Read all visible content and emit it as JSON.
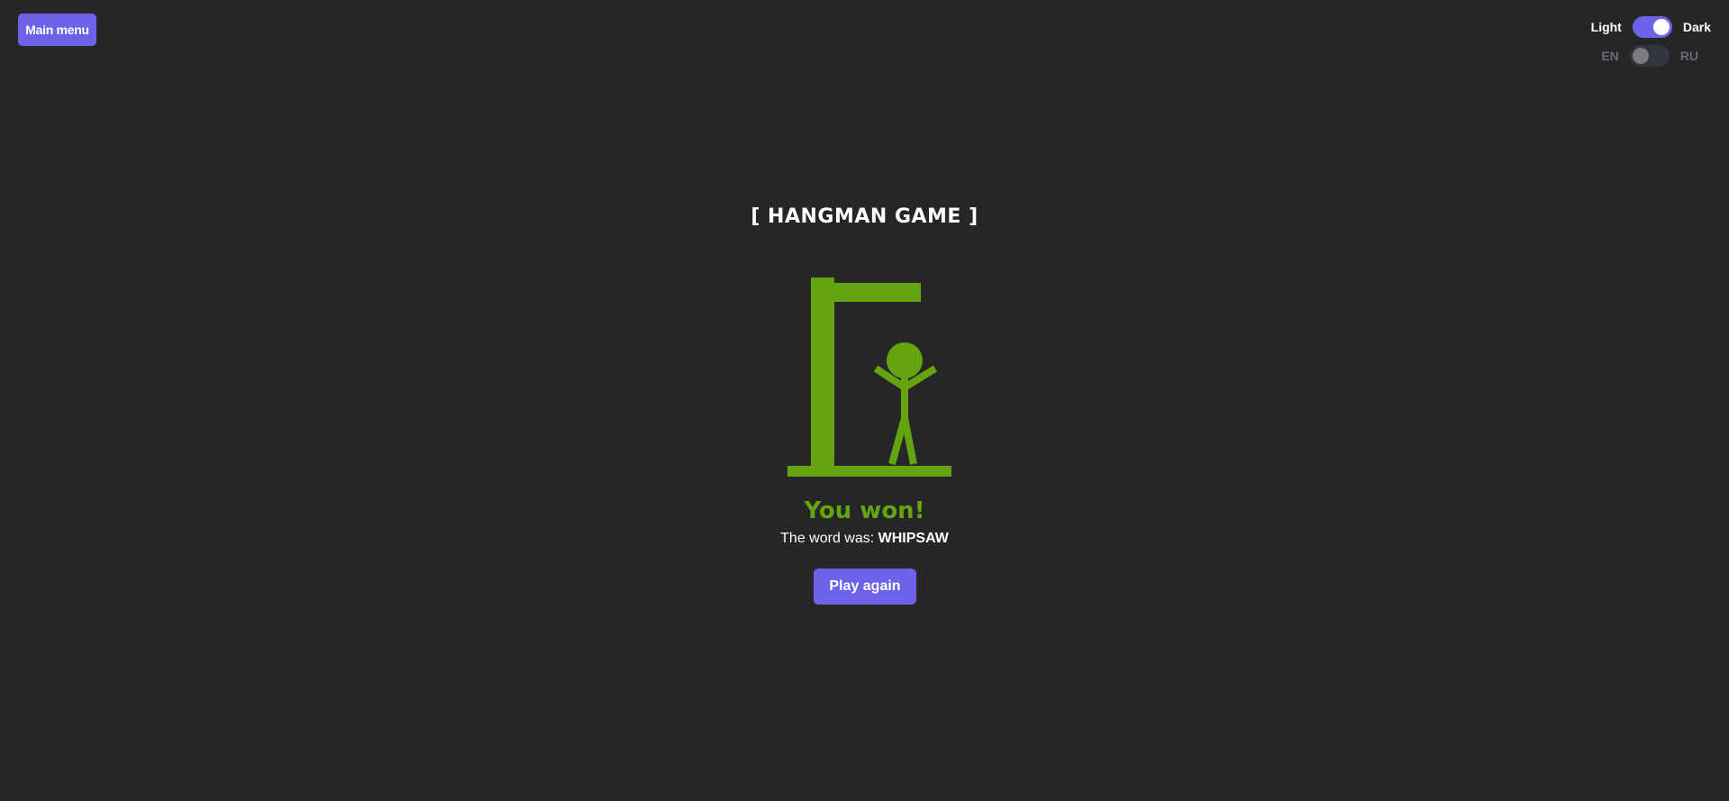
{
  "header": {
    "main_menu_label": "Main menu"
  },
  "theme_toggle": {
    "left_label": "Light",
    "right_label": "Dark",
    "state": "Dark"
  },
  "language_toggle": {
    "left_label": "EN",
    "right_label": "RU",
    "state": "EN"
  },
  "game": {
    "title": "[ HANGMAN GAME ]",
    "result_text": "You won!",
    "word_prefix": "The word was:",
    "word": "WHIPSAW",
    "play_again_label": "Play again"
  },
  "colors": {
    "background": "#262628",
    "accent": "#6c63e8",
    "figure": "#63a40f",
    "text": "#ffffff"
  }
}
